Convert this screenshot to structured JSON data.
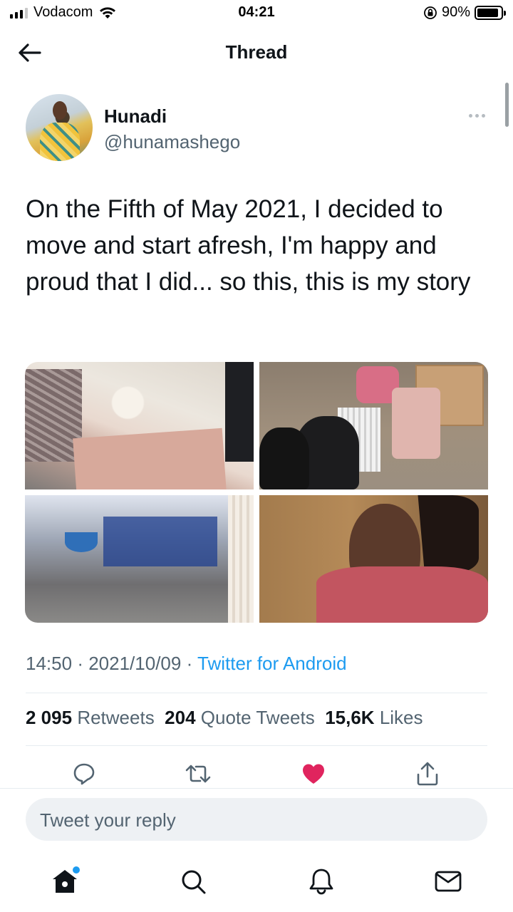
{
  "status_bar": {
    "carrier": "Vodacom",
    "time": "04:21",
    "battery_percent": "90%",
    "battery_level": 0.9
  },
  "header": {
    "title": "Thread"
  },
  "tweet": {
    "author_name": "Hunadi",
    "author_handle": "@hunamashego",
    "text": "On the Fifth of May 2021, I decided to move and start afresh, I'm happy and proud that I did... so this, this is my story",
    "time": "14:50",
    "separator": "·",
    "date": "2021/10/09",
    "source": "Twitter for Android",
    "stats": {
      "retweets_count": "2 095",
      "retweets_label": "Retweets",
      "quotes_count": "204",
      "quotes_label": "Quote Tweets",
      "likes_count": "15,6K",
      "likes_label": "Likes"
    },
    "liked": true,
    "media": [
      "bedding-photo",
      "luggage-photo",
      "room-corner-photo",
      "selfie-photo"
    ]
  },
  "reply": {
    "placeholder": "Tweet your reply"
  },
  "colors": {
    "accent": "#1d9bf0",
    "like": "#f91880",
    "secondary_text": "#536471"
  },
  "icons": {
    "back": "arrow-left-icon",
    "more": "more-horizontal-icon",
    "reply": "comment-icon",
    "retweet": "retweet-icon",
    "like": "heart-icon",
    "share": "share-icon",
    "home": "home-icon",
    "search": "search-icon",
    "notifications": "bell-icon",
    "messages": "mail-icon"
  }
}
